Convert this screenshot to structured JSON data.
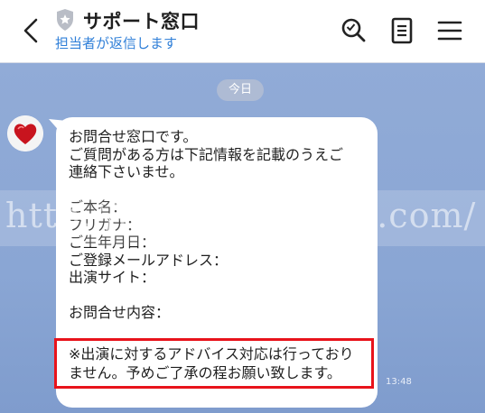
{
  "header": {
    "title": "サポート窓口",
    "subtitle": "担当者が返信します",
    "icons": [
      "back-arrow-icon",
      "shield-badge-icon",
      "search-icon",
      "notes-icon",
      "menu-icon"
    ]
  },
  "chat": {
    "date_label": "今日",
    "message": {
      "body": "お問合せ窓口です。\nご質問がある方は下記情報を記載のうえご\n連絡下さいませ。\n\nご本名：\nフリガナ：\nご生年月日：\nご登録メールアドレス：\n出演サイト：\n\nお問合せ内容：",
      "notice": "※出演に対するアドバイス対応は行っており\nません。予めご了承の程お願い致します。",
      "time": "13:48"
    }
  },
  "watermark": "http://chatlady.rei35.com/",
  "colors": {
    "chat_background": "#8fa9d6",
    "link_blue": "#2f7fd8",
    "highlight_red": "#e8131b"
  }
}
